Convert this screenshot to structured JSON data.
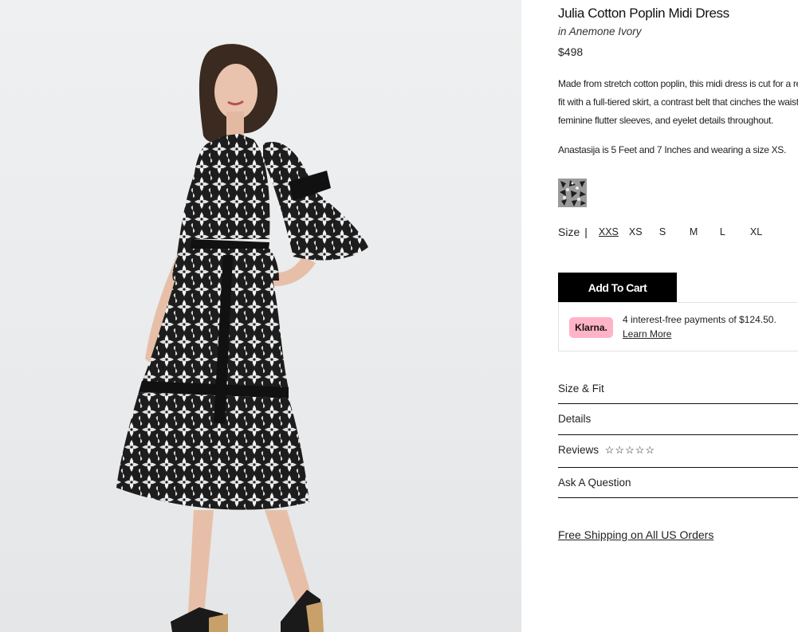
{
  "product": {
    "title": "Julia Cotton Poplin Midi Dress",
    "color_name": "in Anemone Ivory",
    "price": "$498",
    "description": "Made from stretch cotton poplin, this midi dress is cut for a relaxed fit with a full-tiered skirt, a contrast belt that cinches the waist, feminine flutter sleeves, and eyelet details throughout.",
    "model_info": "Anastasija is 5 Feet and 7 Inches and wearing a size XS."
  },
  "swatch": {
    "name": "Anemone Ivory swatch"
  },
  "size": {
    "label": "Size",
    "separator": "|",
    "options": [
      "XXS",
      "XS",
      "S",
      "M",
      "L",
      "XL"
    ],
    "selected": "XXS"
  },
  "cart": {
    "add_label": "Add To Cart"
  },
  "klarna": {
    "badge": "Klarna.",
    "text": "4 interest-free payments of $124.50.",
    "link": "Learn More"
  },
  "accordions": {
    "size_fit": "Size & Fit",
    "details": "Details",
    "reviews": "Reviews",
    "reviews_stars": "☆☆☆☆☆",
    "ask": "Ask A Question"
  },
  "shipping": "Free Shipping on All US Orders",
  "colors": {
    "background": "#ffffff",
    "button": "#000000",
    "klarna_pink": "#ffb3c7"
  }
}
